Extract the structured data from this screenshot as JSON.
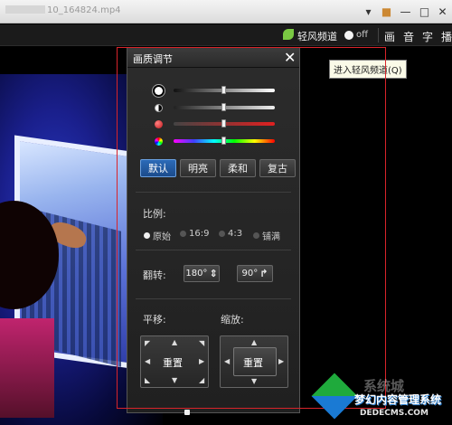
{
  "window": {
    "file_name": "10_164824.mp4",
    "buttons": [
      "▾",
      "■",
      "—",
      "□",
      "✕"
    ]
  },
  "toolbar": {
    "channel_label": "轻风频道",
    "toggle_state": "off",
    "tools": [
      "画",
      "音",
      "字",
      "播"
    ],
    "tooltip": "进入轻风频道(Q)"
  },
  "panel": {
    "title": "画质调节",
    "close": "✕",
    "sliders": [
      {
        "name": "brightness",
        "value": 0.5
      },
      {
        "name": "contrast",
        "value": 0.5
      },
      {
        "name": "saturation",
        "value": 0.5
      },
      {
        "name": "hue",
        "value": 0.5
      }
    ],
    "presets": [
      {
        "label": "默认",
        "active": true
      },
      {
        "label": "明亮",
        "active": false
      },
      {
        "label": "柔和",
        "active": false
      },
      {
        "label": "复古",
        "active": false
      }
    ],
    "ratio_label": "比例:",
    "ratio_options": [
      {
        "label": "原始",
        "selected": true
      },
      {
        "label": "16:9",
        "selected": false
      },
      {
        "label": "4:3",
        "selected": false
      },
      {
        "label": "铺满",
        "selected": false
      }
    ],
    "flip_label": "翻转:",
    "flip_buttons": [
      "180°",
      "90°"
    ],
    "pan_label": "平移:",
    "zoom_label": "缩放:",
    "reset_label": "重置"
  },
  "watermark": {
    "faint": "系统城",
    "name": "梦幻内容管理系统",
    "url": "DEDECMS.COM"
  }
}
